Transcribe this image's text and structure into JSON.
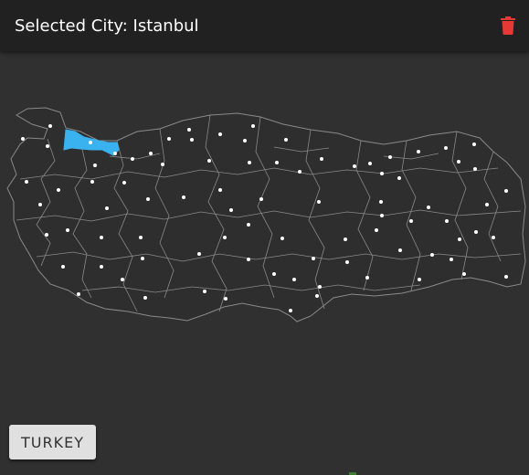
{
  "header": {
    "title": "Selected City: Istanbul",
    "delete_icon": "trash-icon",
    "delete_color": "#e53935"
  },
  "map": {
    "country": "Turkey",
    "selected_city": "Istanbul",
    "highlight_color": "#3ab2f0",
    "border_color": "#8a8a8a",
    "dot_color": "#ffffff"
  },
  "footer": {
    "country_button_label": "TURKEY"
  }
}
